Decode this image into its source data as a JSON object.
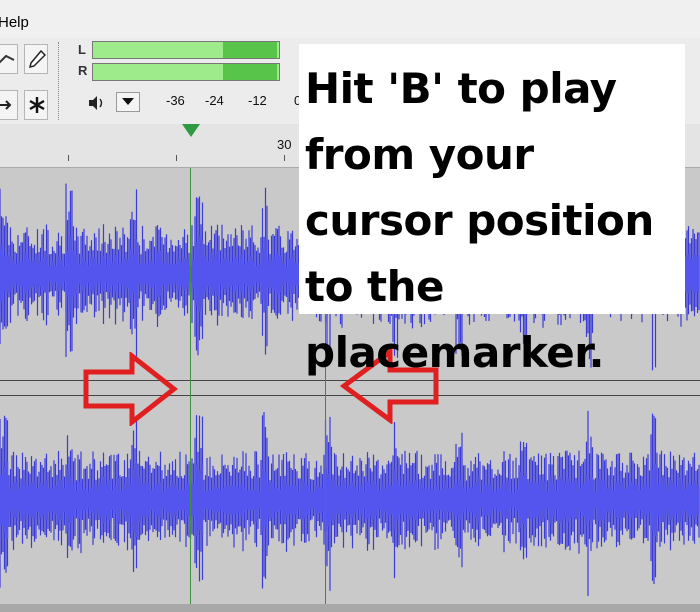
{
  "menu": {
    "help_label": "Help"
  },
  "toolbar": {
    "meter_left_label": "L",
    "meter_right_label": "R",
    "meter_ticks": [
      "-36",
      "-24",
      "-12",
      "0"
    ],
    "speaker_icon": "speaker-icon",
    "colors": {
      "meter_fill": "#9deb8a",
      "meter_peak": "#58c449"
    }
  },
  "ruler": {
    "label": "30"
  },
  "callout": {
    "text": "Hit 'B' to play from your cursor position to the placemarker."
  },
  "colors": {
    "waveform": "#3b3bd8",
    "arrow": "#e02020",
    "cursor_line": "#3f8f3f",
    "play_marker": "#2e9a42"
  }
}
